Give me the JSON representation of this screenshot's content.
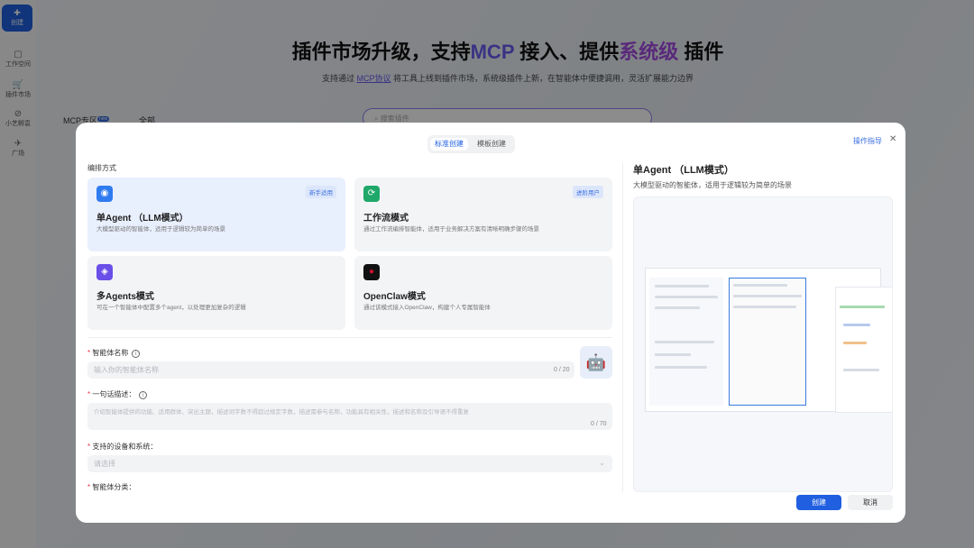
{
  "sidebar": {
    "create": "创建",
    "items": [
      {
        "label": "工作空间",
        "icon": "workspace-icon"
      },
      {
        "label": "插件市场",
        "icon": "cart-icon"
      },
      {
        "label": "小艺孵袁",
        "icon": "compass-icon"
      },
      {
        "label": "广场",
        "icon": "rocket-icon"
      }
    ]
  },
  "hero": {
    "title_a": "插件市场升级，支持",
    "title_mcp": "MCP",
    "title_b": "接入、提供",
    "title_sys": "系统级",
    "title_c": "插件",
    "sub_a": "支持通过",
    "sub_link": "MCP协议",
    "sub_b": "将工具上线到插件市场，系统级插件上新，在智能体中便捷调用，灵活扩展能力边界",
    "search_placeholder": "搜索插件",
    "tabs": [
      "MCP专区",
      "全部"
    ],
    "tab_badge": "new"
  },
  "modal": {
    "segments": [
      "标准创建",
      "模板创建"
    ],
    "guide": "操作指导",
    "section_label": "编排方式",
    "cards": [
      {
        "title": "单Agent （LLM模式）",
        "desc": "大模型驱动的智能体，适用于逻辑较为简单的场景",
        "badge": "新手适用",
        "icon": "robot-icon",
        "color": "#2f7bf0"
      },
      {
        "title": "工作流模式",
        "desc": "通过工作流编排智能体，适用于业务解决方案有清晰明确步骤的场景",
        "badge": "进阶用户",
        "icon": "workflow-icon",
        "color": "#1fa86a"
      },
      {
        "title": "多Agents模式",
        "desc": "可在一个智能体中配置多个agent，以处理更加复杂的逻辑",
        "badge": "",
        "icon": "multi-agent-icon",
        "color": "#6a4fe8"
      },
      {
        "title": "OpenClaw模式",
        "desc": "通过该模式接入OpenClaw，构建个人专属智能体",
        "badge": "",
        "icon": "openclaw-icon",
        "color": "#c0102a"
      }
    ],
    "name_label": "智能体名称",
    "name_placeholder": "输入你的智能体名称",
    "name_count": "0 / 20",
    "desc_label": "一句话描述：",
    "desc_placeholder": "介绍智能体提供的功能、适用群体、突出主题，描述词字数不得超过规定字数，描述需参与名称，功能具有相关性，描述和名称及引导语不得重复",
    "desc_count": "0 / 70",
    "device_label": "支持的设备和系统：",
    "device_placeholder": "请选择",
    "category_label": "智能体分类：",
    "right_title": "单Agent （LLM模式）",
    "right_desc": "大模型驱动的智能体，适用于逻辑较为简单的场景",
    "create": "创建",
    "cancel": "取消"
  }
}
